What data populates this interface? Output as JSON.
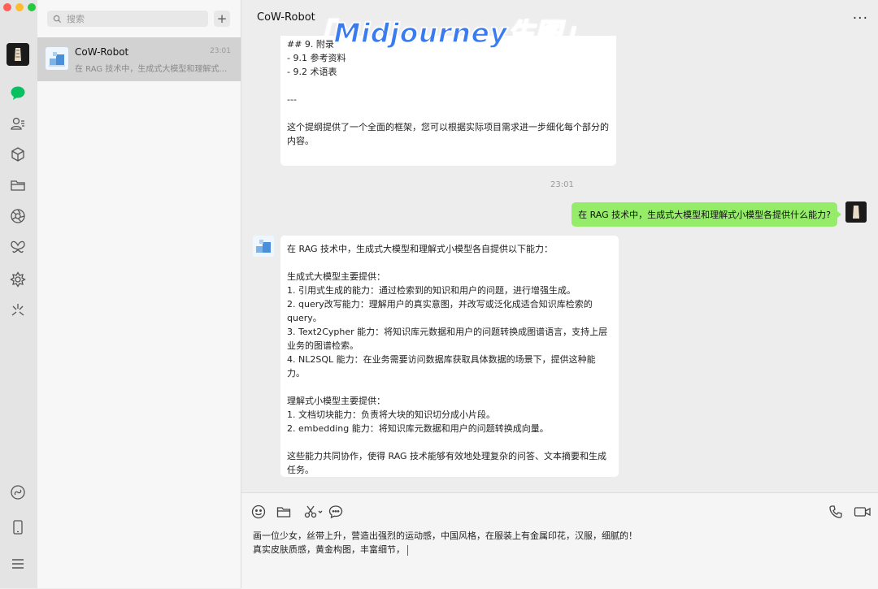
{
  "window": {
    "traffic_colors": [
      "#fe5f57",
      "#febc2e",
      "#28c840"
    ]
  },
  "rail": {
    "icons": [
      "avatar",
      "chat-icon",
      "contacts-icon",
      "cube-icon",
      "folder-icon",
      "aperture-icon",
      "butterfly-icon",
      "gear-flower-icon",
      "spark-icon",
      "link-icon",
      "phone-icon",
      "menu-icon"
    ],
    "accent": "#07c160"
  },
  "list": {
    "search_placeholder": "搜索",
    "add_label": "+",
    "chats": [
      {
        "name": "CoW-Robot",
        "time": "23:01",
        "preview": "在 RAG 技术中，生成式大模型和理解式小..."
      }
    ]
  },
  "chat": {
    "title": "CoW-Robot",
    "more_label": "···",
    "overlay_caption": "「Midjourney生图」",
    "messages": [
      {
        "from": "bot",
        "text": "## 9. 附录\n- 9.1 参考资料\n- 9.2 术语表\n\n---\n\n这个提纲提供了一个全面的框架，您可以根据实际项目需求进一步细化每个部分的内容。"
      },
      {
        "from": "time",
        "text": "23:01"
      },
      {
        "from": "me",
        "text": "在 RAG 技术中，生成式大模型和理解式小模型各提供什么能力?"
      },
      {
        "from": "bot",
        "text": "在 RAG 技术中，生成式大模型和理解式小模型各自提供以下能力：\n\n生成式大模型主要提供：\n1. 引用式生成的能力：通过检索到的知识和用户的问题，进行增强生成。\n2. query改写能力：理解用户的真实意图，并改写或泛化成适合知识库检索的query。\n3. Text2Cypher 能力：将知识库元数据和用户的问题转换成图谱语言，支持上层业务的图谱检索。\n4. NL2SQL 能力：在业务需要访问数据库获取具体数据的场景下，提供这种能力。\n\n理解式小模型主要提供：\n1. 文档切块能力：负责将大块的知识切分成小片段。\n2. embedding 能力：将知识库元数据和用户的问题转换成向量。\n\n这些能力共同协作，使得 RAG 技术能够有效地处理复杂的问答、文本摘要和生成任务。"
      }
    ]
  },
  "composer": {
    "tools": [
      "emoji-icon",
      "folder-icon",
      "scissors-icon",
      "chat-bubble-icon",
      "phone-icon",
      "video-icon"
    ],
    "draft": "画一位少女，丝带上升，营造出强烈的运动感，中国风格，在服装上有金属印花，汉服，细腻的！\n真实皮肤质感，黄金构图，丰富细节，"
  }
}
